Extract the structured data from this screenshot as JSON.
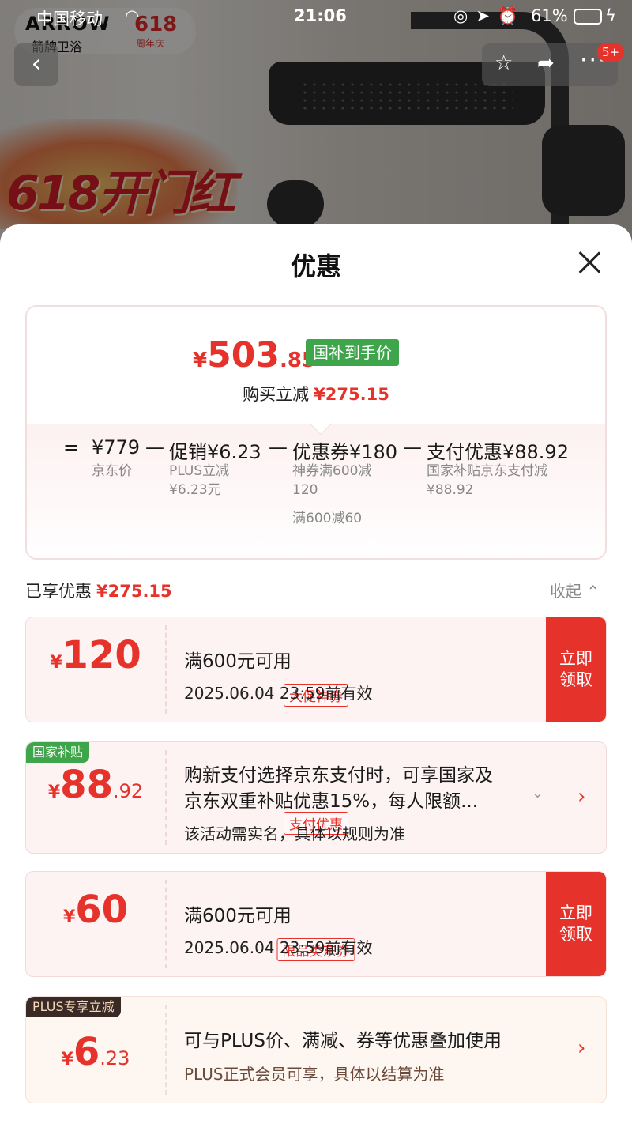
{
  "status_bar": {
    "carrier": "中国移动",
    "time": "21:06",
    "battery": "61%",
    "battery_level": 0.61
  },
  "background": {
    "brand_logo": "ARROW",
    "brand_sub": "箭牌卫浴",
    "brand_618": "618",
    "brand_618_sub": "周年庆",
    "promo": "618开门红",
    "badge_count": "5+"
  },
  "sheet": {
    "title": "优惠",
    "summary": {
      "currency": "¥",
      "price_int": "503",
      "price_dec": ".85",
      "price_tag": "国补到手价",
      "saving_label": "购买立减",
      "saving_amount": "¥275.15",
      "calc": {
        "eq": "=",
        "base": "¥779",
        "base_label": "京东价",
        "minus": "—",
        "promo": "促销¥6.23",
        "promo_sub1": "PLUS立减",
        "promo_sub2": "¥6.23元",
        "coupon": "优惠券¥180",
        "coupon_sub1": "神券满600减",
        "coupon_sub2": "120",
        "coupon_sub3": "满600减60",
        "pay": "支付优惠¥88.92",
        "pay_sub1": "国家补贴京东支付减",
        "pay_sub2": "¥88.92"
      }
    },
    "enjoyed_label": "已享优惠",
    "enjoyed_amount": "¥275.15",
    "collapse_label": "收起",
    "coupons": [
      {
        "currency": "¥",
        "int": "120",
        "dec": "",
        "label": "大促神券",
        "line1": "满600元可用",
        "line2": "2025.06.04 23:59前有效",
        "action": "立即\n领取"
      },
      {
        "corner": "国家补贴",
        "currency": "¥",
        "int": "88",
        "dec": ".92",
        "label": "支付优惠",
        "line1a": "购新支付选择京东支付时，可享国家及",
        "line1b": "京东双重补贴优惠15%，每人限额...",
        "line2": "该活动需实名，具体以规则为准"
      },
      {
        "currency": "¥",
        "int": "60",
        "dec": "",
        "label": "限品类东券",
        "line1": "满600元可用",
        "line2": "2025.06.04 23:59前有效",
        "action": "立即\n领取"
      },
      {
        "corner": "PLUS专享立减",
        "currency": "¥",
        "int": "6",
        "dec": ".23",
        "line1": "可与PLUS价、满减、券等优惠叠加使用",
        "line2": "PLUS正式会员可享，具体以结算为准"
      }
    ]
  },
  "colors": {
    "accent_red": "#e5332c",
    "green_tag": "#3fa54a",
    "plus_dark": "#3a2a26"
  }
}
